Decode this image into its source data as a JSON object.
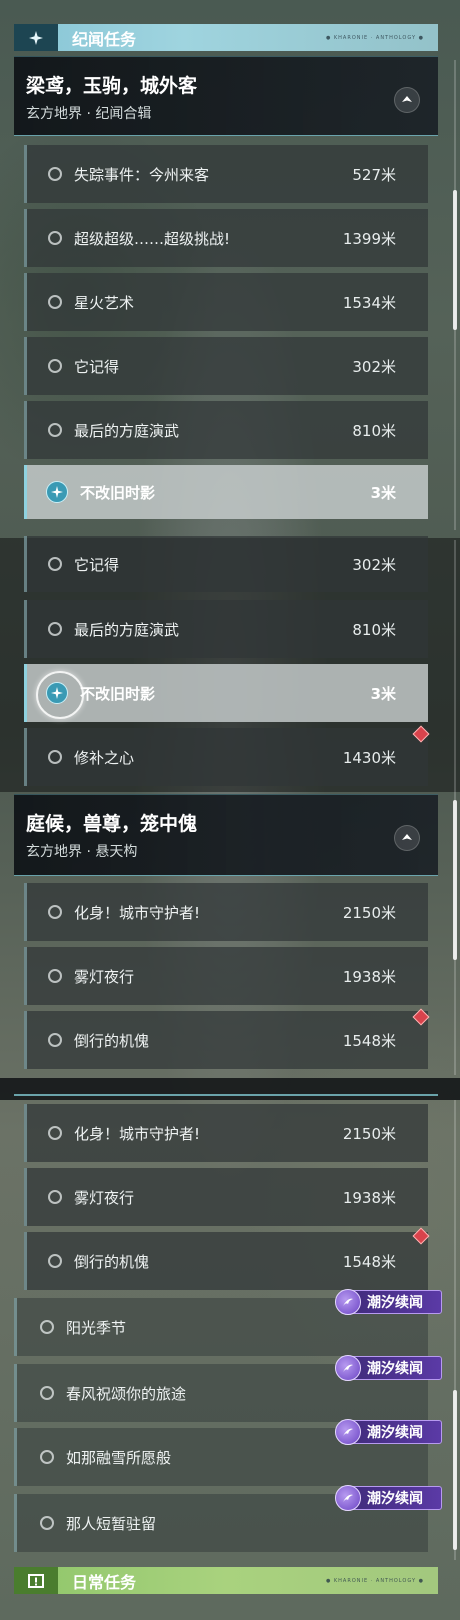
{
  "sections": {
    "story_title": "纪闻任务",
    "story_tag": "● KHARONIE · ANTHOLOGY ●",
    "daily_title": "日常任务",
    "daily_tag": "● KHARONIE · ANTHOLOGY ●"
  },
  "chapter1": {
    "title": "梁鸢，玉驹，城外客",
    "subtitle": "玄方地界 · 纪闻合辑"
  },
  "chapter2": {
    "title": "庭候，兽尊，笼中傀",
    "subtitle": "玄方地界 · 悬天构"
  },
  "block1": [
    {
      "name": "失踪事件：今州来客",
      "dist": "527米"
    },
    {
      "name": "超级超级……超级挑战!",
      "dist": "1399米"
    },
    {
      "name": "星火艺术",
      "dist": "1534米"
    },
    {
      "name": "它记得",
      "dist": "302米"
    },
    {
      "name": "最后的方庭演武",
      "dist": "810米"
    },
    {
      "name": "不改旧时影",
      "dist": "3米"
    }
  ],
  "block2": [
    {
      "name": "它记得",
      "dist": "302米"
    },
    {
      "name": "最后的方庭演武",
      "dist": "810米"
    },
    {
      "name": "不改旧时影",
      "dist": "3米"
    },
    {
      "name": "修补之心",
      "dist": "1430米"
    }
  ],
  "block3": [
    {
      "name": "化身！城市守护者!",
      "dist": "2150米"
    },
    {
      "name": "雾灯夜行",
      "dist": "1938米"
    },
    {
      "name": "倒行的机傀",
      "dist": "1548米"
    }
  ],
  "block4": [
    {
      "name": "化身！城市守护者!",
      "dist": "2150米"
    },
    {
      "name": "雾灯夜行",
      "dist": "1938米"
    },
    {
      "name": "倒行的机傀",
      "dist": "1548米"
    }
  ],
  "tide": [
    {
      "badge": "潮汐续闻",
      "name": "阳光季节"
    },
    {
      "badge": "潮汐续闻",
      "name": "春风祝颂你的旅途"
    },
    {
      "badge": "潮汐续闻",
      "name": "如那融雪所愿般"
    },
    {
      "badge": "潮汐续闻",
      "name": "那人短暂驻留"
    }
  ],
  "colors": {
    "story_accent": "#9fd4df",
    "daily_accent": "#a9d27e",
    "tracked_marker": "#d9434c",
    "tide_badge": "#5b3aa6"
  },
  "icons": [
    "story-quest-icon",
    "collapse-chevron-icon",
    "track-target-icon",
    "tide-wave-icon",
    "daily-quest-icon",
    "waypoint-diamond-icon"
  ]
}
